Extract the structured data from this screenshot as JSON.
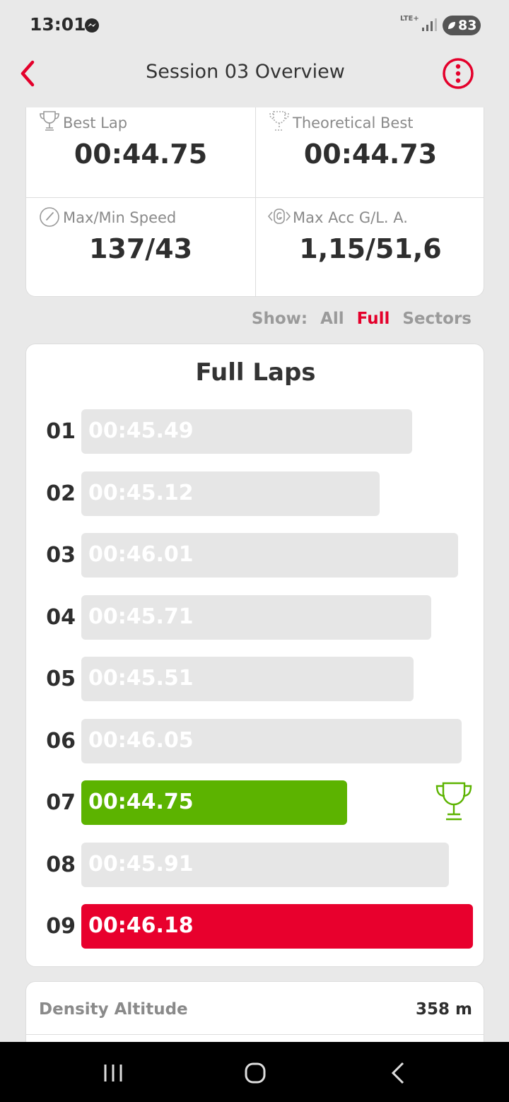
{
  "status_bar": {
    "time": "13:01",
    "network": "LTE+",
    "battery": "83"
  },
  "header": {
    "title": "Session 03 Overview"
  },
  "stats": {
    "best_lap": {
      "label": "Best Lap",
      "value": "00:44.75"
    },
    "theoretical_best": {
      "label": "Theoretical Best",
      "value": "00:44.73"
    },
    "speed": {
      "label": "Max/Min Speed",
      "value": "137/43"
    },
    "acceleration": {
      "label": "Max Acc G/L. A.",
      "value": "1,15/51,6"
    }
  },
  "show_filter": {
    "label": "Show:",
    "options": [
      "All",
      "Full",
      "Sectors"
    ],
    "selected": "Full"
  },
  "laps": {
    "title": "Full Laps",
    "items": [
      {
        "num": "01",
        "time": "00:45.49",
        "seconds": 45.49
      },
      {
        "num": "02",
        "time": "00:45.12",
        "seconds": 45.12
      },
      {
        "num": "03",
        "time": "00:46.01",
        "seconds": 46.01
      },
      {
        "num": "04",
        "time": "00:45.71",
        "seconds": 45.71
      },
      {
        "num": "05",
        "time": "00:45.51",
        "seconds": 45.51
      },
      {
        "num": "06",
        "time": "00:46.05",
        "seconds": 46.05
      },
      {
        "num": "07",
        "time": "00:44.75",
        "seconds": 44.75,
        "status": "best"
      },
      {
        "num": "08",
        "time": "00:45.91",
        "seconds": 45.91
      },
      {
        "num": "09",
        "time": "00:46.18",
        "seconds": 46.18,
        "status": "worst"
      }
    ]
  },
  "density_altitude": {
    "label": "Density Altitude",
    "value": "358 m"
  },
  "colors": {
    "accent": "#e4002b",
    "best": "#5cb300",
    "worst": "#e8002d",
    "bar": "#e6e6e6"
  },
  "icons": {
    "back": "chevron-left-icon",
    "menu": "more-vertical-icon",
    "best_lap": "trophy-icon",
    "theoretical": "trophy-dotted-icon",
    "speed": "speedometer-icon",
    "accel": "g-force-icon"
  }
}
